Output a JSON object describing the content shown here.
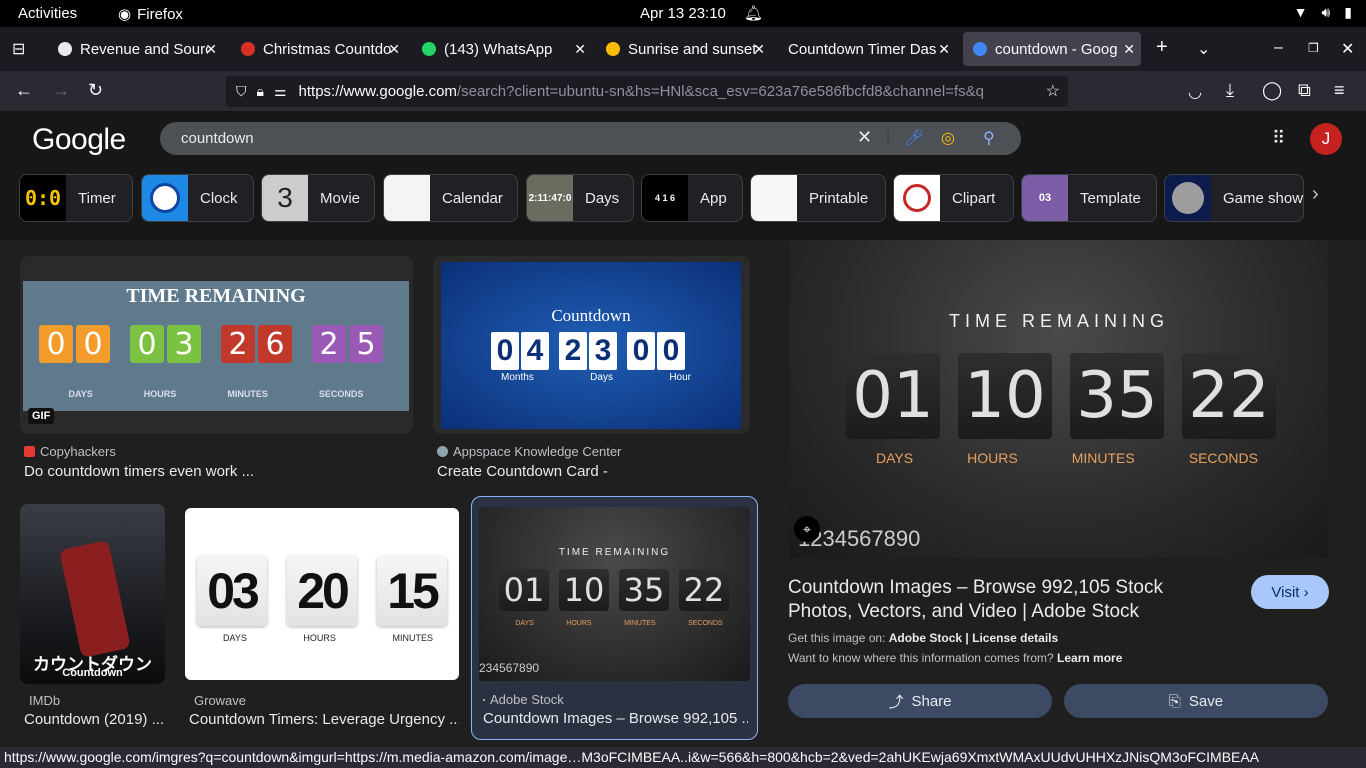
{
  "system": {
    "activities": "Activities",
    "app_name": "Firefox",
    "datetime": "Apr 13  23:10"
  },
  "tabs": [
    {
      "title": "Revenue and Sourc",
      "favicon_color": "#e8eaed"
    },
    {
      "title": "Christmas Countdo",
      "favicon_color": "#d93025"
    },
    {
      "title": "(143) WhatsApp",
      "favicon_color": "#25d366"
    },
    {
      "title": "Sunrise and sunset",
      "favicon_color": "#fbbc04"
    },
    {
      "title": "Countdown Timer Das",
      "favicon_color": "#1c1b22"
    },
    {
      "title": "countdown - Googl",
      "favicon_color": "#4285f4"
    }
  ],
  "navbar": {
    "url_host": "https://www.google.com",
    "url_rest": "/search?client=ubuntu-sn&hs=HNl&sca_esv=623a76e586fbcfd8&channel=fs&q"
  },
  "google": {
    "logo": "Google",
    "query": "countdown",
    "avatar_letter": "J"
  },
  "chips": [
    {
      "label": "Timer",
      "thumb": "0:0"
    },
    {
      "label": "Clock",
      "thumb": ""
    },
    {
      "label": "Movie",
      "thumb": "3"
    },
    {
      "label": "Calendar",
      "thumb": ""
    },
    {
      "label": "Days",
      "thumb": "2:11:47:0"
    },
    {
      "label": "App",
      "thumb": "4 1 6"
    },
    {
      "label": "Printable",
      "thumb": ""
    },
    {
      "label": "Clipart",
      "thumb": ""
    },
    {
      "label": "Template",
      "thumb": "03"
    },
    {
      "label": "Game show",
      "thumb": ""
    }
  ],
  "results": [
    {
      "source": "Copyhackers",
      "title": "Do countdown timers even work ...",
      "img_heading": "TIME REMAINING",
      "digits": [
        "0",
        "0",
        "0",
        "3",
        "2",
        "6",
        "2",
        "5"
      ],
      "units": [
        "DAYS",
        "HOURS",
        "MINUTES",
        "SECONDS"
      ],
      "badge": "GIF"
    },
    {
      "source": "Appspace Knowledge Center",
      "title": "Create Countdown Card -",
      "img_heading": "Countdown",
      "digits": [
        "0",
        "4",
        "2",
        "3",
        "0",
        "0"
      ],
      "units": [
        "Months",
        "Days",
        "Hour"
      ]
    },
    {
      "source": "IMDb",
      "title": "Countdown (2019) ...",
      "poster_text": "カウントダウン",
      "poster_sub": "Countdown"
    },
    {
      "source": "Growave",
      "title": "Countdown Timers: Leverage Urgency ...",
      "digits": [
        "03",
        "20",
        "15"
      ],
      "units": [
        "DAYS",
        "HOURS",
        "MINUTES"
      ]
    },
    {
      "source": "Adobe Stock",
      "title": "Countdown Images – Browse 992,105 ...",
      "img_heading": "TIME REMAINING",
      "digits": [
        "01",
        "10",
        "35",
        "22"
      ],
      "units": [
        "DAYS",
        "HOURS",
        "MINUTES",
        "SECONDS"
      ],
      "watermark": "234567890"
    }
  ],
  "panel": {
    "img_heading": "TIME REMAINING",
    "digits": [
      "01",
      "10",
      "35",
      "22"
    ],
    "units": [
      "DAYS",
      "HOURS",
      "MINUTES",
      "SECONDS"
    ],
    "watermark": "1234567890",
    "title": "Countdown Images – Browse 992,105 Stock Photos, Vectors, and Video | Adobe Stock",
    "visit": "Visit",
    "get_image_prefix": "Get this image on:",
    "get_image_source": "Adobe Stock",
    "separator": "|",
    "license": "License details",
    "want_to_know": "Want to know where this information comes from?",
    "learn_more": "Learn more",
    "share": "Share",
    "save": "Save"
  },
  "statusbar": {
    "url": "https://www.google.com/imgres?q=countdown&imgurl=https://m.media-amazon.com/image…M3oFCIMBEAA..i&w=566&h=800&hcb=2&ved=2ahUKEwja69XmxtWMAxUUdvUHHXzJNisQM3oFCIMBEAA"
  },
  "colors": {
    "accent_visit": "#a8c7fa",
    "avatar": "#c5221f",
    "digit_orange": "#f39c2b",
    "digit_green": "#7cc242",
    "digit_red": "#c0392b",
    "digit_purple": "#9b59b6",
    "panel_units": "#e8a060"
  }
}
